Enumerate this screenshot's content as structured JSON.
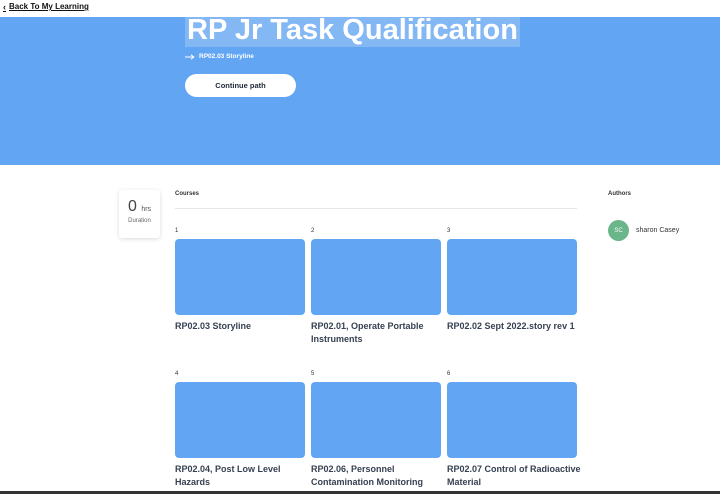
{
  "nav": {
    "back_label": "Back To My Learning"
  },
  "hero": {
    "title": "RP Jr Task Qualification",
    "current_course": "RP02.03 Storyline",
    "continue_label": "Continue path",
    "color": "#62a5f3"
  },
  "duration": {
    "value": "0",
    "unit": "hrs",
    "label": "Duration"
  },
  "courses": {
    "heading": "Courses",
    "items": [
      {
        "number": "1",
        "title": "RP02.03 Storyline"
      },
      {
        "number": "2",
        "title": "RP02.01, Operate Portable Instruments"
      },
      {
        "number": "3",
        "title": "RP02.02 Sept 2022.story rev 1"
      },
      {
        "number": "4",
        "title": "RP02.04, Post Low Level Hazards"
      },
      {
        "number": "5",
        "title": "RP02.06, Personnel Contamination Monitoring"
      },
      {
        "number": "6",
        "title": "RP02.07 Control of Radioactive Material"
      }
    ]
  },
  "authors": {
    "heading": "Authors",
    "items": [
      {
        "initials": "SC",
        "name": "sharon Casey",
        "avatar_color": "#6ab58a"
      }
    ]
  },
  "icons": {
    "back": "chevron-left-icon",
    "current": "arrow-right-icon"
  }
}
